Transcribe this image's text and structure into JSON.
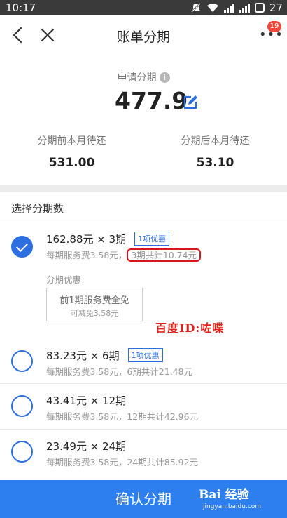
{
  "status_bar": {
    "time": "10:17",
    "battery": "27"
  },
  "nav": {
    "title": "账单分期",
    "badge": "19"
  },
  "summary": {
    "apply_label": "申请分期",
    "amount": "477.9",
    "before_label": "分期前本月待还",
    "before_value": "531.00",
    "after_label": "分期后本月待还",
    "after_value": "53.10"
  },
  "plans_title": "选择分期数",
  "plans": [
    {
      "main": "162.88元 × 3期",
      "tag": "1项优惠",
      "fee": "每期服务费3.58元，",
      "total": "3期共计10.74元",
      "checked": true
    },
    {
      "main": "83.23元 × 6期",
      "tag": "1项优惠",
      "fee": "每期服务费3.58元，",
      "total": "6期共计21.48元",
      "checked": false
    },
    {
      "main": "43.41元 × 12期",
      "tag": "",
      "fee": "每期服务费3.58元，",
      "total": "12期共计42.96元",
      "checked": false
    },
    {
      "main": "23.49元 × 24期",
      "tag": "",
      "fee": "每期服务费3.58元，",
      "total": "24期共计85.92元",
      "checked": false
    }
  ],
  "promo": {
    "label": "分期优惠",
    "title": "前1期服务费全免",
    "subtitle": "可减免3.58元"
  },
  "watermark": "百度ID:咗喋",
  "confirm_label": "确认分期",
  "logo": {
    "brand": "Bai  经验",
    "url": "jingyan.baidu.com"
  },
  "colors": {
    "accent": "#2d6fe0",
    "button": "#2d7ff0",
    "highlight": "#d6161e",
    "badge": "#f0453a"
  },
  "icons": [
    "back-icon",
    "close-icon",
    "more-icon",
    "info-icon",
    "edit-icon",
    "wifi-icon",
    "signal-icon",
    "battery-icon",
    "mute-icon"
  ]
}
